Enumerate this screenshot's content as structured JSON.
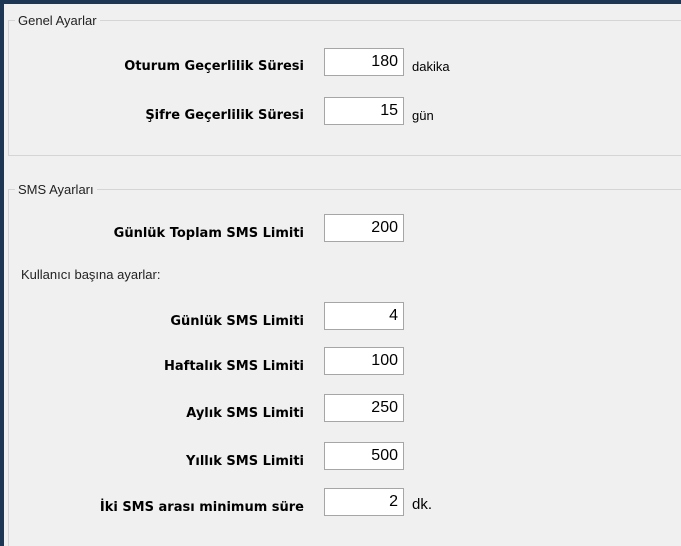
{
  "general": {
    "legend": "Genel Ayarlar",
    "session": {
      "label": "Oturum Geçerlilik Süresi",
      "value": "180",
      "unit": "dakika"
    },
    "password": {
      "label": "Şifre Geçerlilik Süresi",
      "value": "15",
      "unit": "gün"
    }
  },
  "sms": {
    "legend": "SMS Ayarları",
    "total_daily": {
      "label": "Günlük Toplam SMS Limiti",
      "value": "200"
    },
    "per_user_caption": "Kullanıcı başına ayarlar:",
    "daily": {
      "label": "Günlük SMS Limiti",
      "value": "4"
    },
    "weekly": {
      "label": "Haftalık SMS Limiti",
      "value": "100"
    },
    "monthly": {
      "label": "Aylık SMS Limiti",
      "value": "250"
    },
    "yearly": {
      "label": "Yıllık SMS Limiti",
      "value": "500"
    },
    "min_interval": {
      "label": "İki SMS arası minimum süre",
      "value": "2",
      "unit": "dk."
    }
  }
}
